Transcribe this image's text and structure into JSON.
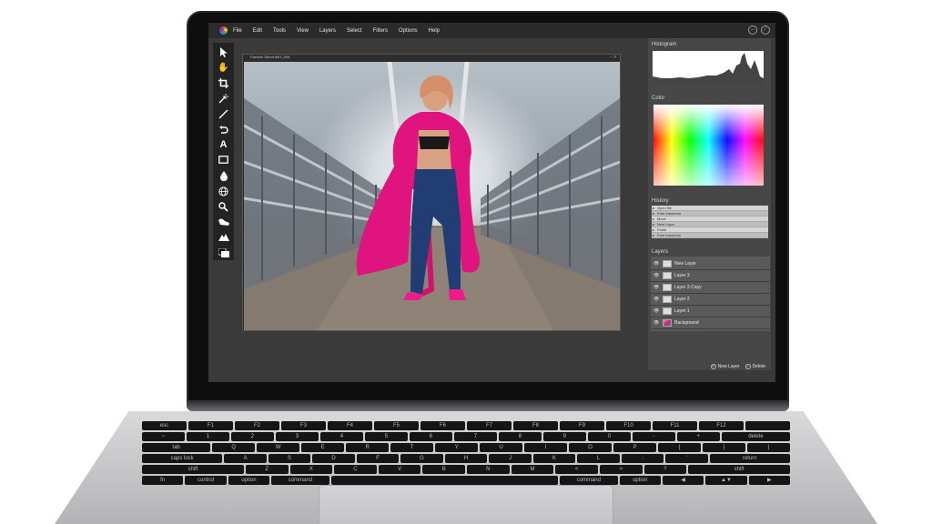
{
  "menu": {
    "items": [
      "File",
      "Edit",
      "Tools",
      "View",
      "Layers",
      "Select",
      "Filters",
      "Options",
      "Help"
    ]
  },
  "tools": [
    "select-arrow",
    "hand",
    "crop",
    "magic-wand",
    "line",
    "undo-arrow",
    "type",
    "rectangle",
    "drop",
    "globe",
    "zoom",
    "smudge",
    "mountains",
    "color-swatch"
  ],
  "document": {
    "title": "Fashion Shoot IMG_008"
  },
  "panels": {
    "histogram_title": "Histogram",
    "color_title": "Color",
    "history_title": "History",
    "history": [
      "Open file",
      "Free transform",
      "Move",
      "New Layer",
      "Paste",
      "Free transform"
    ],
    "layers_title": "Layers",
    "layers": [
      "New Layer",
      "Layer 3",
      "Layer 3 Copy",
      "Layer 2",
      "Layer 1",
      "Background"
    ],
    "new_layer_label": "New Layer",
    "delete_label": "Delete"
  },
  "keyboard": {
    "row1": [
      "esc",
      "F1",
      "F2",
      "F3",
      "F4",
      "F5",
      "F6",
      "F7",
      "F8",
      "F9",
      "F10",
      "F11",
      "F12",
      ""
    ],
    "row2": [
      "~",
      "1",
      "2",
      "3",
      "4",
      "5",
      "6",
      "7",
      "8",
      "9",
      "0",
      "-",
      "+",
      "delete"
    ],
    "row3": [
      "tab",
      "Q",
      "W",
      "E",
      "R",
      "T",
      "Y",
      "U",
      "I",
      "O",
      "P",
      "{",
      "}",
      "|"
    ],
    "row4": [
      "caps lock",
      "A",
      "S",
      "D",
      "F",
      "G",
      "H",
      "J",
      "K",
      "L",
      ";",
      "'",
      "return"
    ],
    "row5": [
      "shift",
      "Z",
      "X",
      "C",
      "V",
      "B",
      "N",
      "M",
      "<",
      ">",
      "?",
      "shift"
    ],
    "row6": [
      "fn",
      "control",
      "option",
      "command",
      "",
      "command",
      "option",
      "◀",
      "▲▼",
      "▶"
    ]
  },
  "colors": {
    "accent": "#d4187f",
    "panel_bg": "#474747",
    "screen_bg": "#3a3a3a"
  }
}
